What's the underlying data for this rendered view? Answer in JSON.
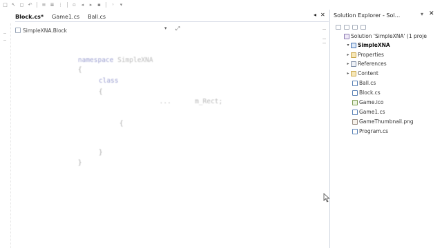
{
  "editor": {
    "tabs": [
      {
        "label": "Block.cs*",
        "active": true
      },
      {
        "label": "Game1.cs",
        "active": false
      },
      {
        "label": "Ball.cs",
        "active": false
      }
    ],
    "navbar": {
      "label": "SimpleXNA.Block"
    },
    "code_lines": [
      {
        "keyword": "namespace",
        "text": " SimpleXNA"
      },
      {
        "keyword": "",
        "text": "{"
      },
      {
        "keyword": "class",
        "text": ""
      },
      {
        "keyword": "",
        "text": "{"
      },
      {
        "keyword": "",
        "text": "        ...      m_Rect;"
      },
      {
        "keyword": "",
        "text": "{"
      },
      {
        "keyword": "",
        "text": "}"
      },
      {
        "keyword": "",
        "text": "}"
      }
    ]
  },
  "solution_explorer": {
    "title": "Solution Explorer - Sol...",
    "items": [
      {
        "label": "Solution 'SimpleXNA' (1 proje",
        "icon": "solution-icon"
      },
      {
        "label": "SimpleXNA",
        "icon": "project-icon"
      },
      {
        "label": "Properties",
        "icon": "properties-icon"
      },
      {
        "label": "References",
        "icon": "references-icon"
      },
      {
        "label": "Content",
        "icon": "content-icon"
      },
      {
        "label": "Ball.cs",
        "icon": "cs-file-icon"
      },
      {
        "label": "Block.cs",
        "icon": "cs-file-icon"
      },
      {
        "label": "Game.ico",
        "icon": "ico-file-icon"
      },
      {
        "label": "Game1.cs",
        "icon": "cs-file-icon"
      },
      {
        "label": "GameThumbnail.png",
        "icon": "png-file-icon"
      },
      {
        "label": "Program.cs",
        "icon": "cs-file-icon"
      }
    ]
  },
  "colors": {
    "keyword": "#9b9fd0",
    "code_text": "#b9b9b9",
    "background": "#ffffff"
  }
}
